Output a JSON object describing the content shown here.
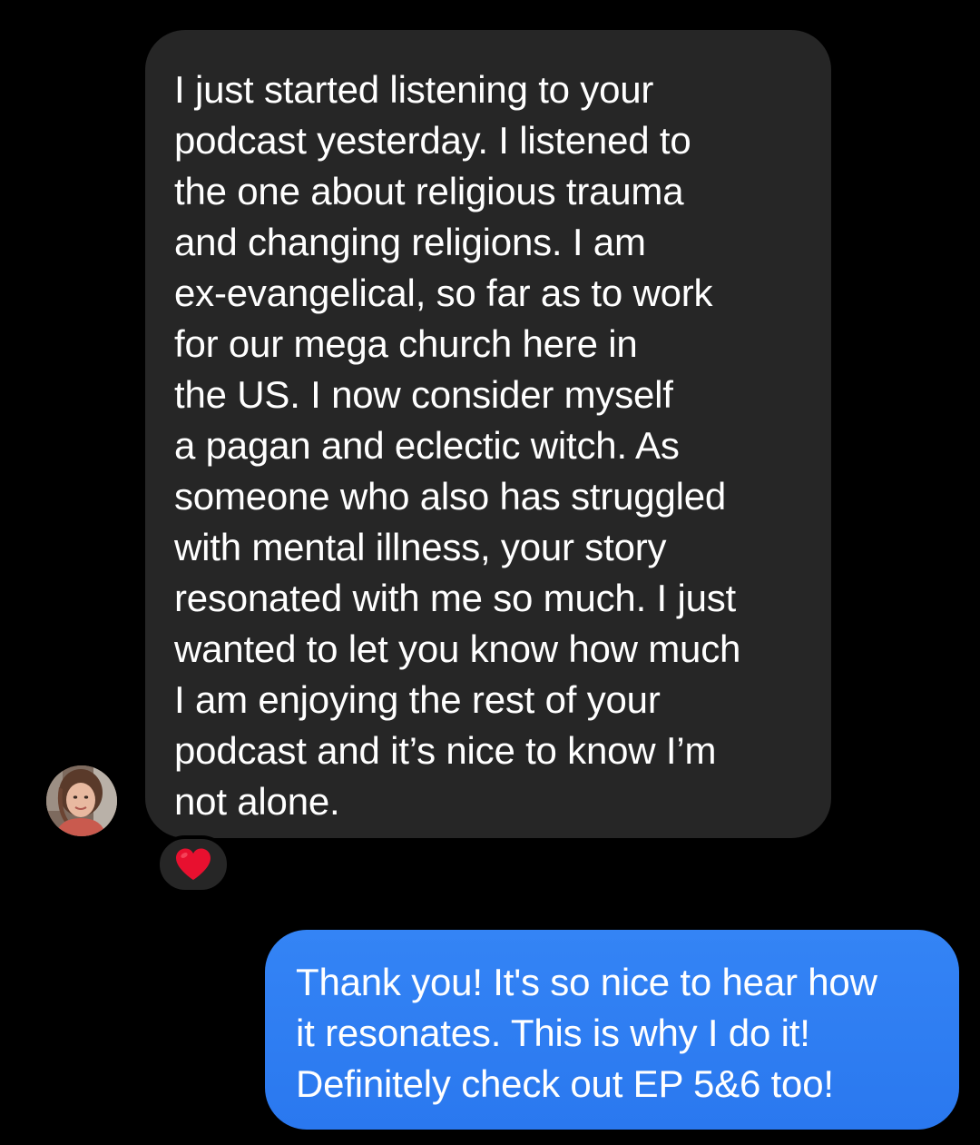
{
  "incoming_message": {
    "lines": [
      "I just started listening to your",
      "podcast yesterday. I listened to",
      "the one about religious trauma",
      "and changing religions. I am",
      "ex-evangelical, so far as to work",
      "for our mega church here in",
      "the US. I now consider myself",
      "a pagan and eclectic witch. As",
      "someone who also has struggled",
      "with mental illness, your story",
      "resonated with me so much. I just",
      "wanted to let you know how much",
      "I am enjoying the rest of your",
      "podcast and it’s nice to know I’m",
      "not alone."
    ],
    "reaction": "heart-icon",
    "bubble_color": "#262626"
  },
  "sender_avatar": {
    "icon": "user-avatar-photo"
  },
  "outgoing_message": {
    "lines": [
      "Thank you! It's so nice to hear how",
      "it resonates. This is why I do it!",
      "Definitely check out EP 5&6 too!"
    ],
    "bubble_color": "#2f7ff2"
  },
  "colors": {
    "background": "#000000",
    "heart": "#e8102f"
  }
}
